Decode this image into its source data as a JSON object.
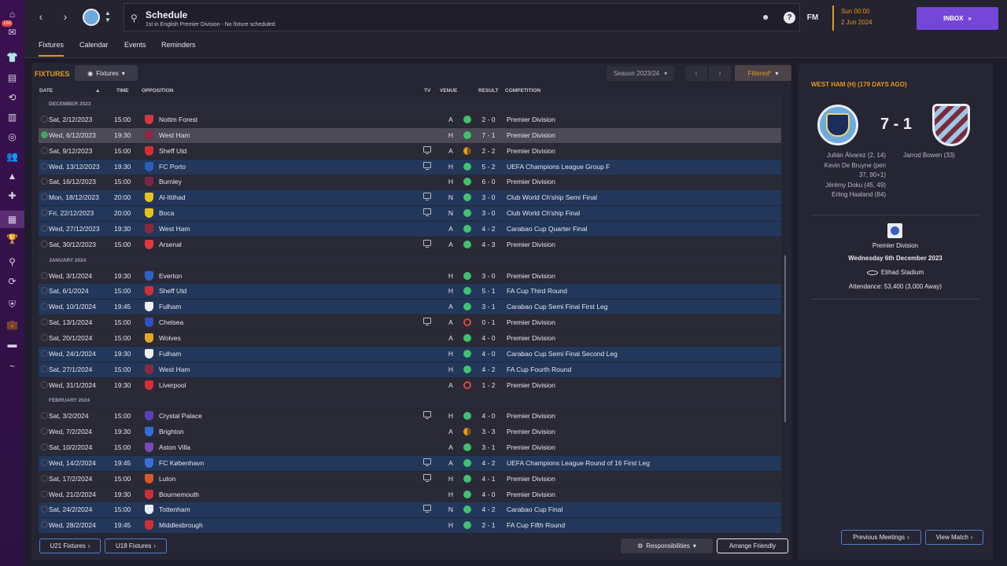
{
  "sidebar": {
    "badge": "150",
    "items": [
      "home-icon",
      "inbox-icon",
      "squad-icon",
      "tactics-icon",
      "dynamics-icon",
      "data-hub-icon",
      "scouting-icon",
      "staff-icon",
      "training-icon",
      "medical-icon",
      "schedule-icon",
      "competitions-icon",
      "search-icon",
      "transfers-icon",
      "club-vision-icon",
      "finances-icon",
      "dev-centre-icon",
      "more-icon"
    ]
  },
  "header": {
    "title": "Schedule",
    "subtitle": "1st in English Premier Division - No fixture scheduled.",
    "fm_label": "FM",
    "day_time": "Sun 00:00",
    "date": "2 Jun 2024",
    "inbox_label": "INBOX"
  },
  "tabs": [
    "Fixtures",
    "Calendar",
    "Events",
    "Reminders"
  ],
  "toolbar": {
    "section_title": "FIXTURES",
    "view_label": "Fixtures",
    "season": "Season 2023/24",
    "filter_label": "Filtered*"
  },
  "columns": {
    "date": "DATE",
    "time": "TIME",
    "opposition": "OPPOSITION",
    "tv": "TV",
    "venue": "VENUE",
    "result": "RESULT",
    "competition": "COMPETITION"
  },
  "months": [
    "DECEMBER 2023",
    "JANUARY 2024",
    "FEBRUARY 2024"
  ],
  "fixtures": [
    {
      "date": "Sat, 2/12/2023",
      "time": "15:00",
      "opp": "Nottm Forest",
      "crest": "#d13a3a",
      "tv": false,
      "venue": "A",
      "res": "w",
      "score": "2 - 0",
      "comp": "Premier Division",
      "cup": false,
      "sel": false
    },
    {
      "date": "Wed, 6/12/2023",
      "time": "19:30",
      "opp": "West Ham",
      "crest": "#8a2a3e",
      "tv": false,
      "venue": "H",
      "res": "w",
      "score": "7 - 1",
      "comp": "Premier Division",
      "cup": false,
      "sel": true
    },
    {
      "date": "Sat, 9/12/2023",
      "time": "15:00",
      "opp": "Sheff Utd",
      "crest": "#d42f36",
      "tv": true,
      "venue": "A",
      "res": "d",
      "score": "2 - 2",
      "comp": "Premier Division",
      "cup": false,
      "sel": false
    },
    {
      "date": "Wed, 13/12/2023",
      "time": "19:30",
      "opp": "FC Porto",
      "crest": "#2a5fb8",
      "tv": true,
      "venue": "H",
      "res": "w",
      "score": "5 - 2",
      "comp": "UEFA Champions League Group F",
      "cup": true,
      "sel": false
    },
    {
      "date": "Sat, 16/12/2023",
      "time": "15:00",
      "opp": "Burnley",
      "crest": "#7a2745",
      "tv": false,
      "venue": "H",
      "res": "w",
      "score": "6 - 0",
      "comp": "Premier Division",
      "cup": false,
      "sel": false
    },
    {
      "date": "Mon, 18/12/2023",
      "time": "20:00",
      "opp": "Al-Ittihad",
      "crest": "#e8c320",
      "tv": true,
      "venue": "N",
      "res": "w",
      "score": "3 - 0",
      "comp": "Club World Ch'ship Semi Final",
      "cup": true,
      "sel": false
    },
    {
      "date": "Fri, 22/12/2023",
      "time": "20:00",
      "opp": "Boca",
      "crest": "#e5c21a",
      "tv": true,
      "venue": "N",
      "res": "w",
      "score": "3 - 0",
      "comp": "Club World Ch'ship Final",
      "cup": true,
      "sel": false
    },
    {
      "date": "Wed, 27/12/2023",
      "time": "19:30",
      "opp": "West Ham",
      "crest": "#8a2a3e",
      "tv": false,
      "venue": "A",
      "res": "w",
      "score": "4 - 2",
      "comp": "Carabao Cup Quarter Final",
      "cup": true,
      "sel": false
    },
    {
      "date": "Sat, 30/12/2023",
      "time": "15:00",
      "opp": "Arsenal",
      "crest": "#e0383e",
      "tv": true,
      "venue": "A",
      "res": "w",
      "score": "4 - 3",
      "comp": "Premier Division",
      "cup": false,
      "sel": false
    },
    {
      "date": "Wed, 3/1/2024",
      "time": "19:30",
      "opp": "Everton",
      "crest": "#2f5fc8",
      "tv": false,
      "venue": "H",
      "res": "w",
      "score": "3 - 0",
      "comp": "Premier Division",
      "cup": false,
      "sel": false
    },
    {
      "date": "Sat, 6/1/2024",
      "time": "15:00",
      "opp": "Sheff Utd",
      "crest": "#d42f36",
      "tv": false,
      "venue": "H",
      "res": "w",
      "score": "5 - 1",
      "comp": "FA Cup Third Round",
      "cup": true,
      "sel": false
    },
    {
      "date": "Wed, 10/1/2024",
      "time": "19:45",
      "opp": "Fulham",
      "crest": "#f0f0f0",
      "tv": false,
      "venue": "A",
      "res": "w",
      "score": "3 - 1",
      "comp": "Carabao Cup Semi Final First Leg",
      "cup": true,
      "sel": false
    },
    {
      "date": "Sat, 13/1/2024",
      "time": "15:00",
      "opp": "Chelsea",
      "crest": "#2f4fc8",
      "tv": true,
      "venue": "A",
      "res": "l",
      "score": "0 - 1",
      "comp": "Premier Division",
      "cup": false,
      "sel": false
    },
    {
      "date": "Sat, 20/1/2024",
      "time": "15:00",
      "opp": "Wolves",
      "crest": "#e8a524",
      "tv": false,
      "venue": "A",
      "res": "w",
      "score": "4 - 0",
      "comp": "Premier Division",
      "cup": false,
      "sel": false
    },
    {
      "date": "Wed, 24/1/2024",
      "time": "19:30",
      "opp": "Fulham",
      "crest": "#f0f0f0",
      "tv": false,
      "venue": "H",
      "res": "w",
      "score": "4 - 0",
      "comp": "Carabao Cup Semi Final Second Leg",
      "cup": true,
      "sel": false
    },
    {
      "date": "Sat, 27/1/2024",
      "time": "15:00",
      "opp": "West Ham",
      "crest": "#8a2a3e",
      "tv": false,
      "venue": "H",
      "res": "w",
      "score": "4 - 2",
      "comp": "FA Cup Fourth Round",
      "cup": true,
      "sel": false
    },
    {
      "date": "Wed, 31/1/2024",
      "time": "19:30",
      "opp": "Liverpool",
      "crest": "#d42f36",
      "tv": false,
      "venue": "A",
      "res": "l",
      "score": "1 - 2",
      "comp": "Premier Division",
      "cup": false,
      "sel": false
    },
    {
      "date": "Sat, 3/2/2024",
      "time": "15:00",
      "opp": "Crystal Palace",
      "crest": "#5a3fb8",
      "tv": true,
      "venue": "H",
      "res": "w",
      "score": "4 - 0",
      "comp": "Premier Division",
      "cup": false,
      "sel": false
    },
    {
      "date": "Wed, 7/2/2024",
      "time": "19:30",
      "opp": "Brighton",
      "crest": "#2f6fd8",
      "tv": false,
      "venue": "A",
      "res": "d",
      "score": "3 - 3",
      "comp": "Premier Division",
      "cup": false,
      "sel": false
    },
    {
      "date": "Sat, 10/2/2024",
      "time": "15:00",
      "opp": "Aston Villa",
      "crest": "#7a4ab8",
      "tv": false,
      "venue": "A",
      "res": "w",
      "score": "3 - 1",
      "comp": "Premier Division",
      "cup": false,
      "sel": false
    },
    {
      "date": "Wed, 14/2/2024",
      "time": "19:45",
      "opp": "FC København",
      "crest": "#3a6fd8",
      "tv": true,
      "venue": "A",
      "res": "w",
      "score": "4 - 2",
      "comp": "UEFA Champions League Round of 16  First Leg",
      "cup": true,
      "sel": false
    },
    {
      "date": "Sat, 17/2/2024",
      "time": "15:00",
      "opp": "Luton",
      "crest": "#d45a2a",
      "tv": true,
      "venue": "H",
      "res": "w",
      "score": "4 - 1",
      "comp": "Premier Division",
      "cup": false,
      "sel": false
    },
    {
      "date": "Wed, 21/2/2024",
      "time": "19:30",
      "opp": "Bournemouth",
      "crest": "#c82f36",
      "tv": false,
      "venue": "H",
      "res": "w",
      "score": "4 - 0",
      "comp": "Premier Division",
      "cup": false,
      "sel": false
    },
    {
      "date": "Sat, 24/2/2024",
      "time": "15:00",
      "opp": "Tottenham",
      "crest": "#e8eef6",
      "tv": true,
      "venue": "N",
      "res": "w",
      "score": "4 - 2",
      "comp": "Carabao Cup Final",
      "cup": true,
      "sel": false
    },
    {
      "date": "Wed, 28/2/2024",
      "time": "19:45",
      "opp": "Middlesbrough",
      "crest": "#d42f36",
      "tv": false,
      "venue": "H",
      "res": "w",
      "score": "2 - 1",
      "comp": "FA Cup Fifth Round",
      "cup": true,
      "sel": false
    }
  ],
  "footer": {
    "u21": "U21 Fixtures",
    "u18": "U18 Fixtures",
    "responsibilities": "Responsibilities",
    "arrange": "Arrange Friendly"
  },
  "match_panel": {
    "title": "WEST HAM (H) (179 DAYS AGO)",
    "score": "7 - 1",
    "home_scorers": [
      "Julián Álvarez (2, 14)",
      "Kevin De Bruyne (pen",
      "37, 90+1)",
      "Jérémy Doku (45, 49)",
      "Erling Haaland (84)"
    ],
    "away_scorers": [
      "Jarrod Bowen (33)"
    ],
    "competition": "Premier Division",
    "match_date": "Wednesday 6th December 2023",
    "stadium": "Etihad Stadium",
    "attendance": "Attendance: 53,400 (3,000 Away)",
    "prev_meetings": "Previous Meetings",
    "view_match": "View Match"
  }
}
